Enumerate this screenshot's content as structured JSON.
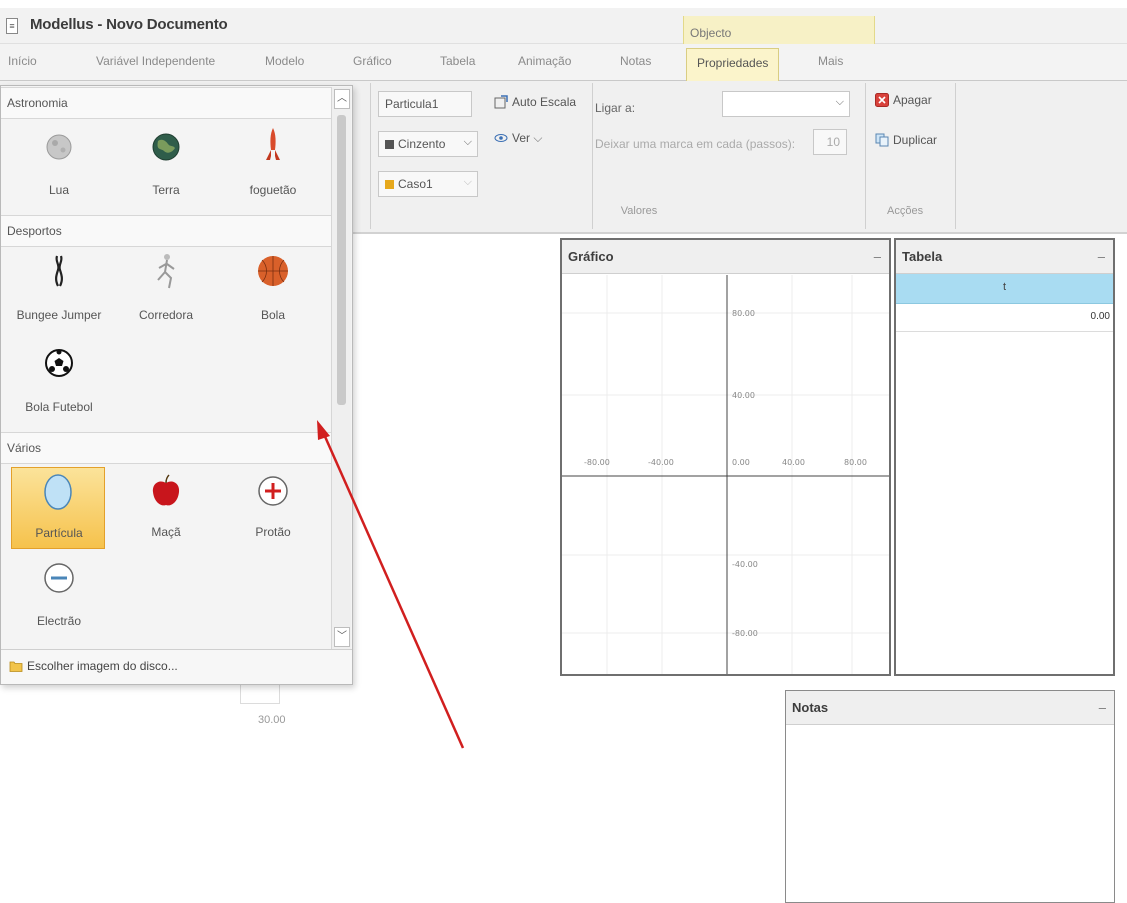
{
  "window": {
    "title": "Modellus - Novo Documento",
    "context_group": "Objecto"
  },
  "tabs": [
    "Início",
    "Variável Independente",
    "Modelo",
    "Gráfico",
    "Tabela",
    "Animação",
    "Notas",
    "Propriedades",
    "Mais"
  ],
  "ribbon": {
    "object_name": "Particula1",
    "color_select": "Cinzento",
    "case_select": "Caso1",
    "auto_scale": "Auto Escala",
    "view": "Ver",
    "link_label": "Ligar a:",
    "link_value": "",
    "mark_label": "Deixar uma marca em cada (passos):",
    "mark_value": "10",
    "group_values": "Valores",
    "delete": "Apagar",
    "duplicate": "Duplicar",
    "group_actions": "Acções"
  },
  "palette": {
    "categories": [
      {
        "name": "Astronomia",
        "items": [
          "Lua",
          "Terra",
          "foguetão"
        ]
      },
      {
        "name": "Desportos",
        "items": [
          "Bungee Jumper",
          "Corredora",
          "Bola",
          "Bola Futebol"
        ]
      },
      {
        "name": "Vários",
        "items": [
          "Partícula",
          "Maçã",
          "Protão",
          "Electrão"
        ]
      }
    ],
    "selected_item": "Partícula",
    "choose_image": "Escolher imagem do disco..."
  },
  "graph": {
    "title": "Gráfico",
    "x_ticks": [
      "-80.00",
      "-40.00",
      "0.00",
      "40.00",
      "80.00"
    ],
    "y_ticks": [
      "80.00",
      "40.00",
      "-40.00",
      "-80.00"
    ]
  },
  "table": {
    "title": "Tabela",
    "column": "t",
    "value": "0.00"
  },
  "notes": {
    "title": "Notas"
  },
  "canvas": {
    "axis_value": "30.00"
  },
  "colors": {
    "context_tab": "#fbf4cb",
    "table_header": "#a9dcf2",
    "selection": "#f6c24c",
    "arrow": "#d11f1f"
  }
}
